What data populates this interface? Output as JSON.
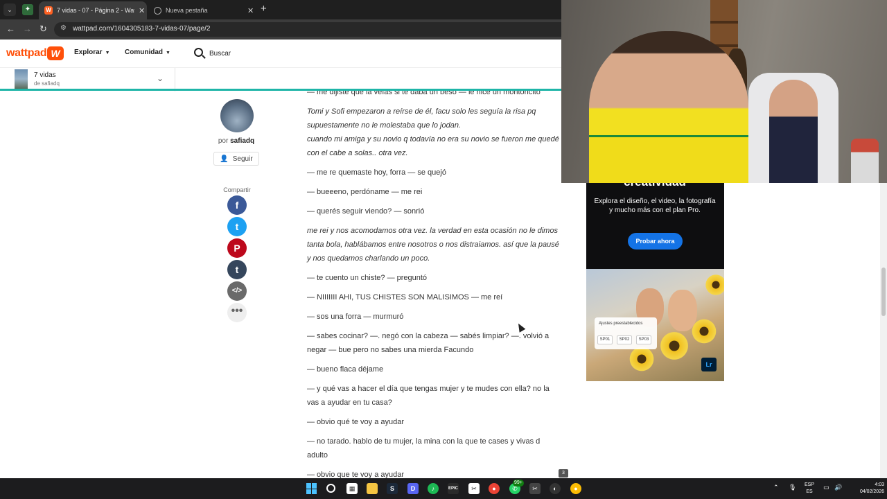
{
  "browser": {
    "tabs": [
      {
        "label": "7 vidas - 07 - Página 2 - Wattpad",
        "active": true
      },
      {
        "label": "Nueva pestaña",
        "active": false
      }
    ],
    "url": "wattpad.com/1604305183-7-vidas-07/page/2"
  },
  "header": {
    "logo": "wattpad",
    "nav": [
      {
        "label": "Explorar"
      },
      {
        "label": "Comunidad"
      }
    ],
    "search_label": "Buscar"
  },
  "story": {
    "title": "7 vidas",
    "author_line": "de safiadq"
  },
  "author_panel": {
    "by_prefix": "por",
    "username": "safiadq",
    "follow_label": "Seguir",
    "share_label": "Compartir",
    "share_icons": [
      "facebook-icon",
      "twitter-icon",
      "pinterest-icon",
      "tumblr-icon",
      "embed-icon",
      "more-icon"
    ]
  },
  "reading": {
    "paragraphs": [
      {
        "text": "— me dijiste que la veías si te daba un beso — le hice un montoncito",
        "italic": false
      },
      {
        "text": "Tomi y Sofi empezaron a reírse de él, facu solo les seguía la risa pq supuestamente no le molestaba que lo jodan.\ncuando mi amiga y su novio q todavía no era su novio se fueron me quedé con el cabe a solas.. otra vez.",
        "italic": true
      },
      {
        "text": "— me re quemaste hoy, forra — se quejó",
        "italic": false
      },
      {
        "text": "— bueeeno, perdóname — me rei",
        "italic": false
      },
      {
        "text": "— querés seguir viendo? — sonrió",
        "italic": false
      },
      {
        "text": "me rei y nos acomodamos otra vez. la verdad en esta ocasión no le dimos tanta bola, hablábamos entre nosotros o nos distraiamos. así que la pausé y nos quedamos charlando un poco.",
        "italic": true
      },
      {
        "text": "— te cuento un chiste? — preguntó",
        "italic": false
      },
      {
        "text": "— NIIIIIII AHI, TUS CHISTES SON MALISIMOS — me reí",
        "italic": false
      },
      {
        "text": "— sos una forra — murmuró",
        "italic": false
      },
      {
        "text": "— sabes cocinar? —. negó con la cabeza — sabés limpiar? —. volvió a negar — bue pero no sabes una mierda Facundo",
        "italic": false
      },
      {
        "text": "— bueno flaca déjame",
        "italic": false
      },
      {
        "text": "— y qué vas a hacer el día que tengas mujer y te mudes con ella? no la vas a ayudar en tu casa?",
        "italic": false
      },
      {
        "text": "— obvio qué te voy a ayudar",
        "italic": false
      },
      {
        "text": "— no tarado. hablo de tu mujer, la mina con la que te cases y vivas d adulto",
        "italic": false
      },
      {
        "text": "— obvio que te voy a ayudar",
        "italic": false
      }
    ]
  },
  "ad": {
    "headline": "creatividad",
    "body": "Explora el diseño, el video, la fotografía y mucho más con el plan Pro.",
    "cta": "Probar ahora",
    "preset_title": "Ajustes preestablecidos",
    "presets": [
      "SP01",
      "SP02",
      "SP03"
    ],
    "app_badge": "Lr",
    "accent": "#1473e6"
  },
  "taskbar": {
    "badge_count": "99+",
    "window_count": "3",
    "lang_top": "ESP",
    "lang_bottom": "ES",
    "time": "4:03",
    "date": "04/02/2026"
  },
  "colors": {
    "brand": "#ff500a",
    "progress": "#1fb5a8"
  }
}
